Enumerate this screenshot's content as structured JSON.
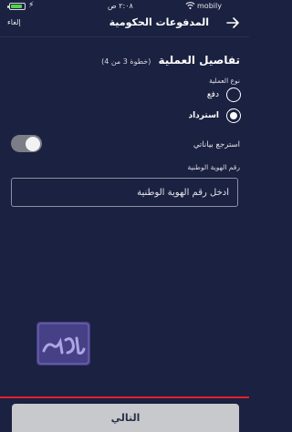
{
  "status_bar": {
    "carrier": "mobily",
    "time": "٢:٠٨ ص",
    "battery_level": 0.85,
    "battery_color": "#54d14e",
    "icons": [
      "wifi-icon",
      "battery-icon",
      "charging-icon"
    ]
  },
  "nav": {
    "title": "المدفوعات الحكومية",
    "cancel_label": "إلغاء",
    "forward_icon": "arrow-right-icon"
  },
  "section": {
    "title": "تفاصيل العملية",
    "step": "(خطوة 3 من 4)"
  },
  "operation_type": {
    "label": "نوع العملية",
    "options": [
      {
        "label": "دفع",
        "selected": false
      },
      {
        "label": "استرداد",
        "selected": true
      }
    ]
  },
  "refund_toggle": {
    "label": "استرجع بياناتي",
    "on": false
  },
  "national_id": {
    "label": "رقم الهوية الوطنية",
    "placeholder": "أدخل رقم الهوية الوطنية",
    "value": ""
  },
  "watermark": {
    "text": "المرجع",
    "color": "#6a5bc0"
  },
  "footer": {
    "next_label": "التالي",
    "accent_color": "#e0202c"
  }
}
